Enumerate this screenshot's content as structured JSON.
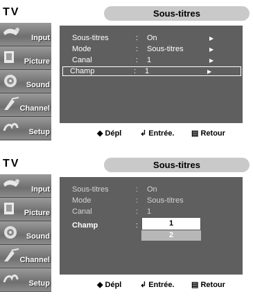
{
  "menu": {
    "tv_label": "TV",
    "title": "Sous-titres",
    "sidebar": [
      "Input",
      "Picture",
      "Sound",
      "Channel",
      "Setup"
    ],
    "footer": {
      "move": "◆ Dépl",
      "enter": "Entrée.",
      "return": "Retour"
    }
  },
  "top_panel": {
    "rows": [
      {
        "label": "Sous-titres",
        "colon": ":",
        "value": "On"
      },
      {
        "label": "Mode",
        "colon": ":",
        "value": "Sous-titres"
      },
      {
        "label": "Canal",
        "colon": ":",
        "value": "1"
      },
      {
        "label": "Champ",
        "colon": ":",
        "value": "1"
      }
    ]
  },
  "bottom_panel": {
    "rows": [
      {
        "label": "Sous-titres",
        "colon": ":",
        "value": "On"
      },
      {
        "label": "Mode",
        "colon": ":",
        "value": "Sous-titres"
      },
      {
        "label": "Canal",
        "colon": ":",
        "value": "1"
      },
      {
        "label": "Champ",
        "colon": ":"
      }
    ],
    "dropdown": {
      "selected": "1",
      "other": "2"
    }
  },
  "colors": {
    "content_bg": "#5f5f5f",
    "title_pill": "#c9c9c9",
    "sidebar": "#7a7a7a"
  }
}
